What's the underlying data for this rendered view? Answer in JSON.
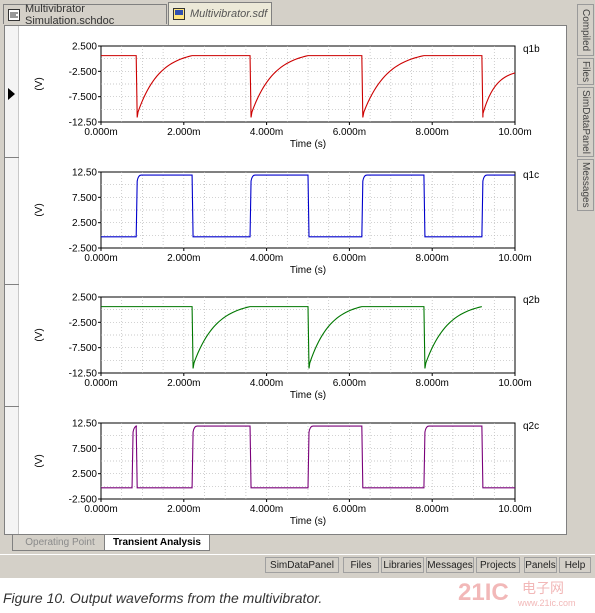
{
  "tabs": {
    "schematic": "Multivibrator Simulation.schdoc",
    "sdf": "Multivibrator.sdf"
  },
  "side_panels": [
    "Compiled",
    "Files",
    "SimDataPanel",
    "Messages"
  ],
  "x_axis": {
    "label": "Time (s)",
    "ticks": [
      "0.000m",
      "2.000m",
      "4.000m",
      "6.000m",
      "8.000m",
      "10.00m"
    ],
    "range": [
      0,
      10
    ]
  },
  "y_unit": "(V)",
  "chart_data": [
    {
      "type": "line",
      "series": [
        {
          "name": "q1b",
          "color": "#cc0000"
        }
      ],
      "y_ticks": [
        "2.500",
        "-2.500",
        "-7.500",
        "-12.50"
      ],
      "ylim": [
        -12.5,
        2.5
      ],
      "xlabel": "Time (s)",
      "ylabel": "(V)",
      "high": 0.6,
      "low": -11.6,
      "x_start": 0,
      "x_start_y": 0.6,
      "edges": [
        {
          "x": 0.85,
          "dir": "down"
        },
        {
          "x": 3.6,
          "dir": "down"
        },
        {
          "x": 6.3,
          "dir": "down"
        },
        {
          "x": 9.2,
          "dir": "down"
        }
      ],
      "recover_x": [
        2.2,
        5.0,
        7.8
      ]
    },
    {
      "type": "line",
      "series": [
        {
          "name": "q1c",
          "color": "#0000cc"
        }
      ],
      "y_ticks": [
        "12.50",
        "7.500",
        "2.500",
        "-2.500"
      ],
      "ylim": [
        -2.5,
        12.5
      ],
      "xlabel": "Time (s)",
      "ylabel": "(V)",
      "high": 11.9,
      "low": -0.3,
      "x_start": 0,
      "x_start_y": -0.3,
      "edges": [
        {
          "x": 0.85,
          "dir": "up"
        },
        {
          "x": 2.2,
          "dir": "down"
        },
        {
          "x": 3.6,
          "dir": "up"
        },
        {
          "x": 5.0,
          "dir": "down"
        },
        {
          "x": 6.3,
          "dir": "up"
        },
        {
          "x": 7.8,
          "dir": "down"
        },
        {
          "x": 9.2,
          "dir": "up"
        }
      ]
    },
    {
      "type": "line",
      "series": [
        {
          "name": "q2b",
          "color": "#007700"
        }
      ],
      "y_ticks": [
        "2.500",
        "-2.500",
        "-7.500",
        "-12.50"
      ],
      "ylim": [
        -12.5,
        2.5
      ],
      "xlabel": "Time (s)",
      "ylabel": "(V)",
      "high": 0.6,
      "low": -11.6,
      "x_start": 0,
      "x_start_y": 0.6,
      "edges": [
        {
          "x": 2.2,
          "dir": "down"
        },
        {
          "x": 5.0,
          "dir": "down"
        },
        {
          "x": 7.8,
          "dir": "down"
        }
      ],
      "recover_x": [
        3.6,
        6.3,
        9.2
      ]
    },
    {
      "type": "line",
      "series": [
        {
          "name": "q2c",
          "color": "#7a007a"
        }
      ],
      "y_ticks": [
        "12.50",
        "7.500",
        "2.500",
        "-2.500"
      ],
      "ylim": [
        -2.5,
        12.5
      ],
      "xlabel": "Time (s)",
      "ylabel": "(V)",
      "high": 11.9,
      "low": -0.3,
      "x_start": 0,
      "x_start_y": -0.3,
      "edges": [
        {
          "x": 0.75,
          "dir": "up"
        },
        {
          "x": 0.85,
          "dir": "down"
        },
        {
          "x": 2.2,
          "dir": "up"
        },
        {
          "x": 3.6,
          "dir": "down"
        },
        {
          "x": 5.0,
          "dir": "up"
        },
        {
          "x": 6.3,
          "dir": "down"
        },
        {
          "x": 7.8,
          "dir": "up"
        },
        {
          "x": 9.2,
          "dir": "down"
        }
      ]
    }
  ],
  "analysis_tabs": {
    "operating_point": "Operating Point",
    "transient": "Transient Analysis"
  },
  "status_bar": [
    "SimDataPanel",
    "Files",
    "Libraries",
    "Messages",
    "Projects",
    "Panels",
    "Help"
  ],
  "caption": "Figure 10. Output waveforms from the multivibrator.",
  "watermark": "21IC 电子网 www.21ic.com"
}
